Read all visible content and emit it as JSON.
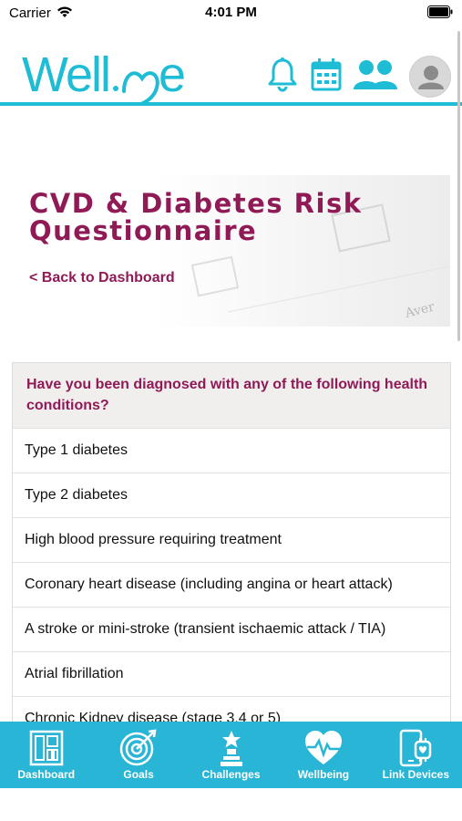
{
  "status_bar": {
    "carrier": "Carrier",
    "time": "4:01 PM"
  },
  "header": {
    "logo_text": "Wellme",
    "icons": [
      "bell-icon",
      "calendar-icon",
      "people-icon",
      "avatar"
    ]
  },
  "hero": {
    "title": "CVD & Diabetes Risk Questionnaire",
    "back_link": "< Back to Dashboard",
    "background_word": "Aver"
  },
  "question": {
    "text": "Have you been diagnosed with any of the following health conditions?",
    "options": [
      "Type 1 diabetes",
      "Type 2 diabetes",
      "High blood pressure requiring treatment",
      "Coronary heart disease (including angina or heart attack)",
      "A stroke or mini-stroke (transient ischaemic attack / TIA)",
      "Atrial fibrillation",
      "Chronic Kidney disease (stage 3,4 or 5)"
    ]
  },
  "bottom_nav": {
    "items": [
      {
        "label": "Dashboard",
        "icon": "dashboard-icon"
      },
      {
        "label": "Goals",
        "icon": "target-icon"
      },
      {
        "label": "Challenges",
        "icon": "trophy-icon"
      },
      {
        "label": "Wellbeing",
        "icon": "heart-pulse-icon"
      },
      {
        "label": "Link Devices",
        "icon": "devices-icon"
      }
    ]
  },
  "colors": {
    "brand": "#1fbcd6",
    "accent": "#8f1a56",
    "nav_bg": "#29b6d6"
  }
}
